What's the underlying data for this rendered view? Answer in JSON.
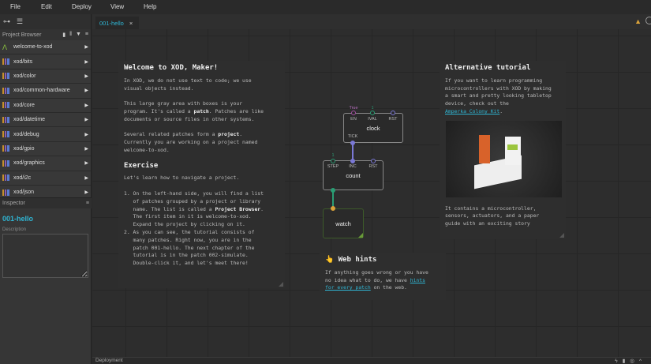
{
  "menu": [
    "File",
    "Edit",
    "Deploy",
    "View",
    "Help"
  ],
  "sidebar": {
    "project_browser_label": "Project Browser",
    "items": [
      {
        "label": "welcome-to-xod",
        "type": "project"
      },
      {
        "label": "xod/bits"
      },
      {
        "label": "xod/color"
      },
      {
        "label": "xod/common-hardware"
      },
      {
        "label": "xod/core"
      },
      {
        "label": "xod/datetime"
      },
      {
        "label": "xod/debug"
      },
      {
        "label": "xod/gpio"
      },
      {
        "label": "xod/graphics"
      },
      {
        "label": "xod/i2c"
      },
      {
        "label": "xod/json"
      }
    ]
  },
  "inspector": {
    "label": "Inspector",
    "patch_name": "001-hello",
    "description_label": "Description",
    "description_value": ""
  },
  "tab": {
    "label": "001-hello",
    "close": "×"
  },
  "welcome": {
    "title": "Welcome to XOD, Maker!",
    "p1": "In XOD, we do not use text to code; we use\nvisual objects instead.",
    "p2a": "This large gray area with boxes is your\nprogram. It's called a ",
    "p2b": "patch",
    "p2c": ". Patches are like\ndocuments or source files in other systems.",
    "p3a": "Several related patches form a ",
    "p3b": "project",
    "p3c": ".\nCurrently you are working on a project named\nwelcome-to-xod.",
    "exercise_title": "Exercise",
    "p4": "Let's learn how to navigate a project.",
    "l1a": "1. On the left-hand side, you will find a list\n   of patches grouped by a project or library\n   name. The list is called a ",
    "l1b": "Project Browser",
    "l1c": ".\n   The first item in it is welcome-to-xod.\n   Expand the project by clicking on it.",
    "l2": "2. As you can see, the tutorial consists of\n   many patches. Right now, you are in the\n   patch 001-hello. The next chapter of the\n   tutorial is in the patch 002-simulate.\n   Double-click it, and let's meet there!"
  },
  "alt": {
    "title": "Alternative tutorial",
    "p1": "If you want to learn programming\nmicrocontrollers with XOD by making\na smart and pretty looking tabletop\ndevice, check out the\n",
    "link": "Amperka Colony Kit",
    "p1end": ".",
    "p2": "It contains a microcontroller,\nsensors, actuators, and a paper\nguide with an exciting story"
  },
  "hints": {
    "title": "Web hints",
    "emoji": "👆",
    "p1": "If anything goes wrong or you have\nno idea what to do, we have ",
    "link": "hints\nfor every patch",
    "p1end": " on the web."
  },
  "nodes": {
    "clock": {
      "label": "clock",
      "pins": [
        "EN",
        "IVAL",
        "RST"
      ],
      "out": "TICK",
      "en_value": "True",
      "ival_value": "1"
    },
    "count": {
      "label": "count",
      "pins": [
        "STEP",
        "INC",
        "RST"
      ],
      "step_value": "1"
    },
    "watch": {
      "label": "watch"
    }
  },
  "deployment": {
    "label": "Deployment"
  },
  "colors": {
    "accent": "#2fb5d3",
    "pulse": "#7a78d6",
    "number": "#2a9d74",
    "boolean": "#a24fa0",
    "string": "#d9a23a"
  }
}
